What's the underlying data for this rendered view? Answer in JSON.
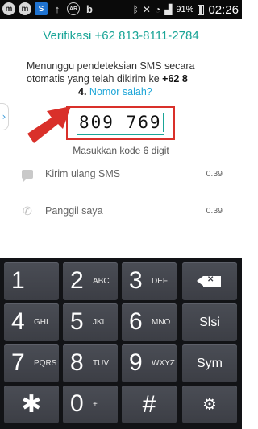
{
  "status_bar": {
    "left_icons": [
      "m",
      "m",
      "S",
      "↑",
      "AR",
      "b"
    ],
    "battery_percent": "91%",
    "time": "02:26"
  },
  "verify": {
    "title": "Verifikasi +62 813-8111-2784",
    "message_part1": "Menunggu pendeteksian SMS secara otomatis yang telah dikirim ke ",
    "message_number_visible": "+62 8",
    "message_number_end": "4.",
    "wrong_number_link": "Nomor salah?",
    "code_value": "809 769",
    "hint": "Masukkan kode 6 digit"
  },
  "options": [
    {
      "icon": "message-icon",
      "label": "Kirim ulang SMS",
      "timer": "0.39"
    },
    {
      "icon": "phone-icon",
      "label": "Panggil saya",
      "timer": "0.39"
    }
  ],
  "keyboard": {
    "keys": [
      {
        "num": "1",
        "letters": ""
      },
      {
        "num": "2",
        "letters": "ABC"
      },
      {
        "num": "3",
        "letters": "DEF"
      },
      {
        "num": "4",
        "letters": "GHI"
      },
      {
        "num": "5",
        "letters": "JKL"
      },
      {
        "num": "6",
        "letters": "MNO"
      },
      {
        "num": "7",
        "letters": "PQRS"
      },
      {
        "num": "8",
        "letters": "TUV"
      },
      {
        "num": "9",
        "letters": "WXYZ"
      },
      {
        "num": "0",
        "letters": "+"
      }
    ],
    "next_label": "Slsi",
    "sym_label": "Sym",
    "star_label": "✱",
    "hash_label": "#",
    "settings_label": "⚙"
  },
  "colors": {
    "accent": "#1aa597",
    "highlight_box": "#d9302a",
    "link": "#1ea6d8"
  }
}
